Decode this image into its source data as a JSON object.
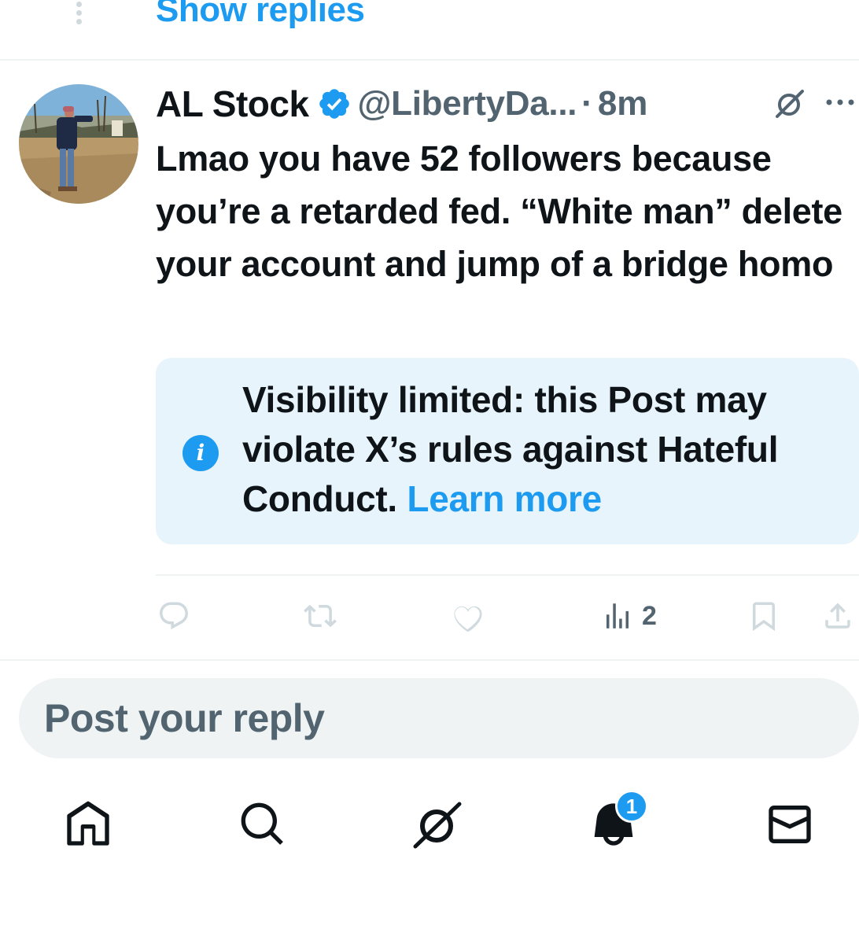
{
  "thread": {
    "show_replies_label": "Show replies"
  },
  "tweet": {
    "author_name": "AL Stock",
    "handle": "@LibertyDa...",
    "separator": "·",
    "time": "8m",
    "text": "Lmao you have 52 followers because you’re a retarded fed. “White man” delete your account and jump of a bridge homo",
    "views": "2"
  },
  "notice": {
    "text": "Visibility limited: this Post may violate X’s rules against Hateful Conduct.",
    "link_label": "Learn more",
    "icon": "info-icon"
  },
  "actions": {
    "icons": [
      "reply-icon",
      "repost-icon",
      "like-icon",
      "views-icon",
      "bookmark-icon",
      "share-icon"
    ]
  },
  "reply": {
    "placeholder": "Post your reply"
  },
  "nav": {
    "items": [
      "home-icon",
      "search-icon",
      "grok-icon",
      "notifications-icon",
      "messages-icon"
    ],
    "notifications_badge": "1"
  },
  "colors": {
    "accent": "#1d9bf0",
    "secondary_text": "#536471",
    "primary_text": "#0f1419",
    "notice_bg": "#e8f4fc",
    "reply_bg": "#eff3f4"
  }
}
